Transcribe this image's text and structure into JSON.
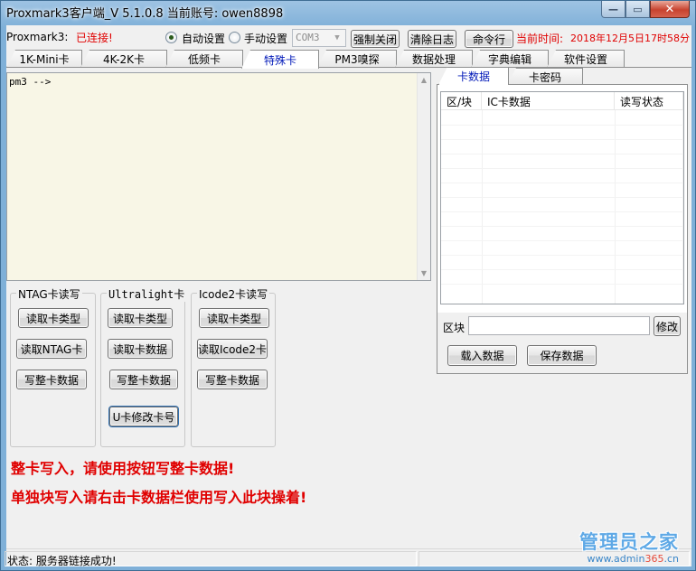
{
  "window": {
    "title": "Proxmark3客户端_V 5.1.0.8  当前账号: owen8898",
    "minimize_glyph": "—",
    "maximize_glyph": "▭",
    "close_glyph": "✕"
  },
  "connection": {
    "label": "Proxmark3:",
    "status": "已连接!",
    "auto_label": "自动设置",
    "manual_label": "手动设置",
    "auto_selected": true,
    "port": "COM3",
    "force_close": "强制关闭",
    "clear_log": "清除日志",
    "command_line": "命令行",
    "time_label": "当前时间:",
    "time_value": "2018年12月5日17时58分"
  },
  "tabs": [
    {
      "label": "1K-Mini卡",
      "active": false
    },
    {
      "label": "4K-2K卡",
      "active": false
    },
    {
      "label": "低频卡",
      "active": false
    },
    {
      "label": "特殊卡",
      "active": true
    },
    {
      "label": "PM3嗅探",
      "active": false
    },
    {
      "label": "数据处理",
      "active": false
    },
    {
      "label": "字典编辑",
      "active": false
    },
    {
      "label": "软件设置",
      "active": false
    }
  ],
  "console": {
    "prompt": "pm3 -->"
  },
  "groups": {
    "ntag": {
      "title": "NTAG卡读写",
      "buttons": [
        "读取卡类型",
        "读取NTAG卡",
        "写整卡数据"
      ]
    },
    "ultralight": {
      "title": "Ultralight卡",
      "buttons": [
        "读取卡类型",
        "读取卡数据",
        "写整卡数据",
        "U卡修改卡号"
      ]
    },
    "icode2": {
      "title": "Icode2卡读写",
      "buttons": [
        "读取卡类型",
        "读取Icode2卡",
        "写整卡数据"
      ]
    }
  },
  "notices": [
    "整卡写入，请使用按钮写整卡数据!",
    "单独块写入请右击卡数据栏使用写入此块操着!"
  ],
  "right_panel": {
    "tabs": [
      {
        "label": "卡数据",
        "active": true
      },
      {
        "label": "卡密码",
        "active": false
      }
    ],
    "columns": [
      "区/块",
      "IC卡数据",
      "读写状态"
    ],
    "block_label": "区块",
    "block_value": "",
    "modify": "修改",
    "load": "载入数据",
    "save": "保存数据"
  },
  "status_bar": {
    "text": "状态: 服务器链接成功!"
  },
  "watermark": {
    "title": "管理员之家",
    "url_prefix": "www.admin",
    "url_num": "365",
    "url_suffix": ".cn"
  }
}
